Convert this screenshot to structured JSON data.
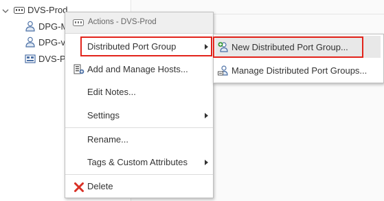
{
  "tree": {
    "root": {
      "label": "DVS-Prod",
      "icon": "distributed-switch-icon"
    },
    "children": [
      {
        "label": "DPG-M",
        "icon": "port-group-icon"
      },
      {
        "label": "DPG-v",
        "icon": "port-group-icon"
      },
      {
        "label": "DVS-P",
        "icon": "uplink-group-icon"
      }
    ]
  },
  "menu": {
    "header": "Actions - DVS-Prod",
    "items": [
      {
        "label": "Distributed Port Group",
        "submenu": true
      },
      {
        "label": "Add and Manage Hosts...",
        "icon": "hosts-icon"
      },
      {
        "label": "Edit Notes..."
      },
      {
        "label": "Settings",
        "submenu": true
      },
      {
        "label": "Rename..."
      },
      {
        "label": "Tags & Custom Attributes",
        "submenu": true
      },
      {
        "label": "Delete",
        "icon": "delete-x-icon"
      }
    ]
  },
  "submenu": {
    "items": [
      {
        "label": "New Distributed Port Group...",
        "icon": "new-port-group-icon"
      },
      {
        "label": "Manage Distributed Port Groups...",
        "icon": "manage-port-groups-icon"
      }
    ]
  },
  "colors": {
    "highlight_border": "#e2231a",
    "delete_red": "#d93025"
  }
}
